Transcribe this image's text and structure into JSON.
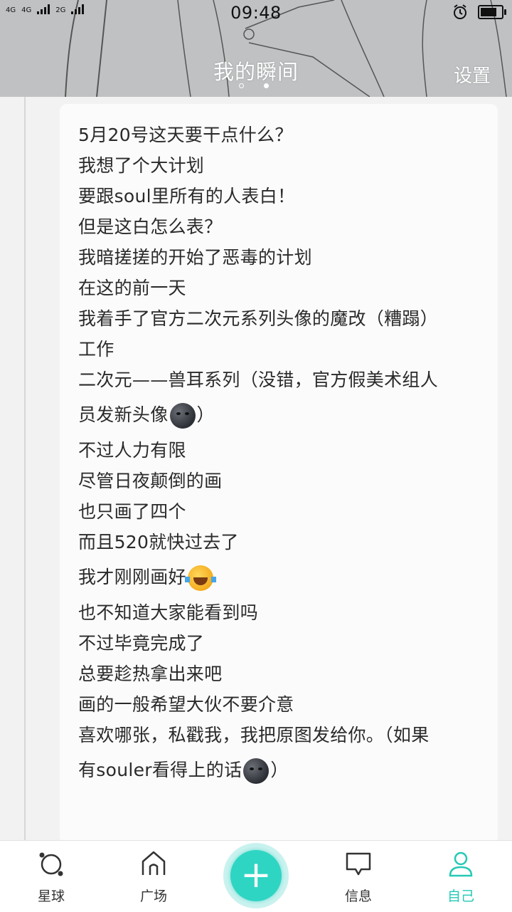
{
  "status_bar": {
    "net1": "4G",
    "net2": "4G",
    "net3": "2G",
    "time": "09:48"
  },
  "header": {
    "title": "我的瞬间",
    "settings": "设置",
    "page_indicator": {
      "count": 2,
      "active": 2
    }
  },
  "post": {
    "lines": [
      "5月20号这天要干点什么？",
      "我想了个大计划",
      "要跟soul里所有的人表白！",
      "但是这白怎么表？",
      "我暗搓搓的开始了恶毒的计划",
      "在这的前一天",
      "我着手了官方二次元系列头像的魔改（糟蹋）",
      "工作",
      "二次元——兽耳系列（没错，官方假美术组人",
      "员发新头像",
      "）",
      "不过人力有限",
      "尽管日夜颠倒的画",
      "也只画了四个",
      "而且520就快过去了",
      "我才刚刚画好",
      "也不知道大家能看到吗",
      "不过毕竟完成了",
      "总要趁热拿出来吧",
      "画的一般希望大伙不要介意",
      "喜欢哪张，私戳我，我把原图发给你。（如果",
      "有souler看得上的话",
      "）"
    ],
    "emoji": {
      "moon": "new-moon-face-emoji",
      "laugh": "tears-of-joy-emoji"
    }
  },
  "nav": {
    "items": [
      {
        "label": "星球",
        "icon": "planet-icon"
      },
      {
        "label": "广场",
        "icon": "home-icon"
      },
      {
        "label": "信息",
        "icon": "message-icon"
      },
      {
        "label": "自己",
        "icon": "profile-icon"
      }
    ],
    "fab_icon": "plus-icon",
    "active_color": "#25c9b6",
    "fab_color": "#2fd5c3"
  }
}
